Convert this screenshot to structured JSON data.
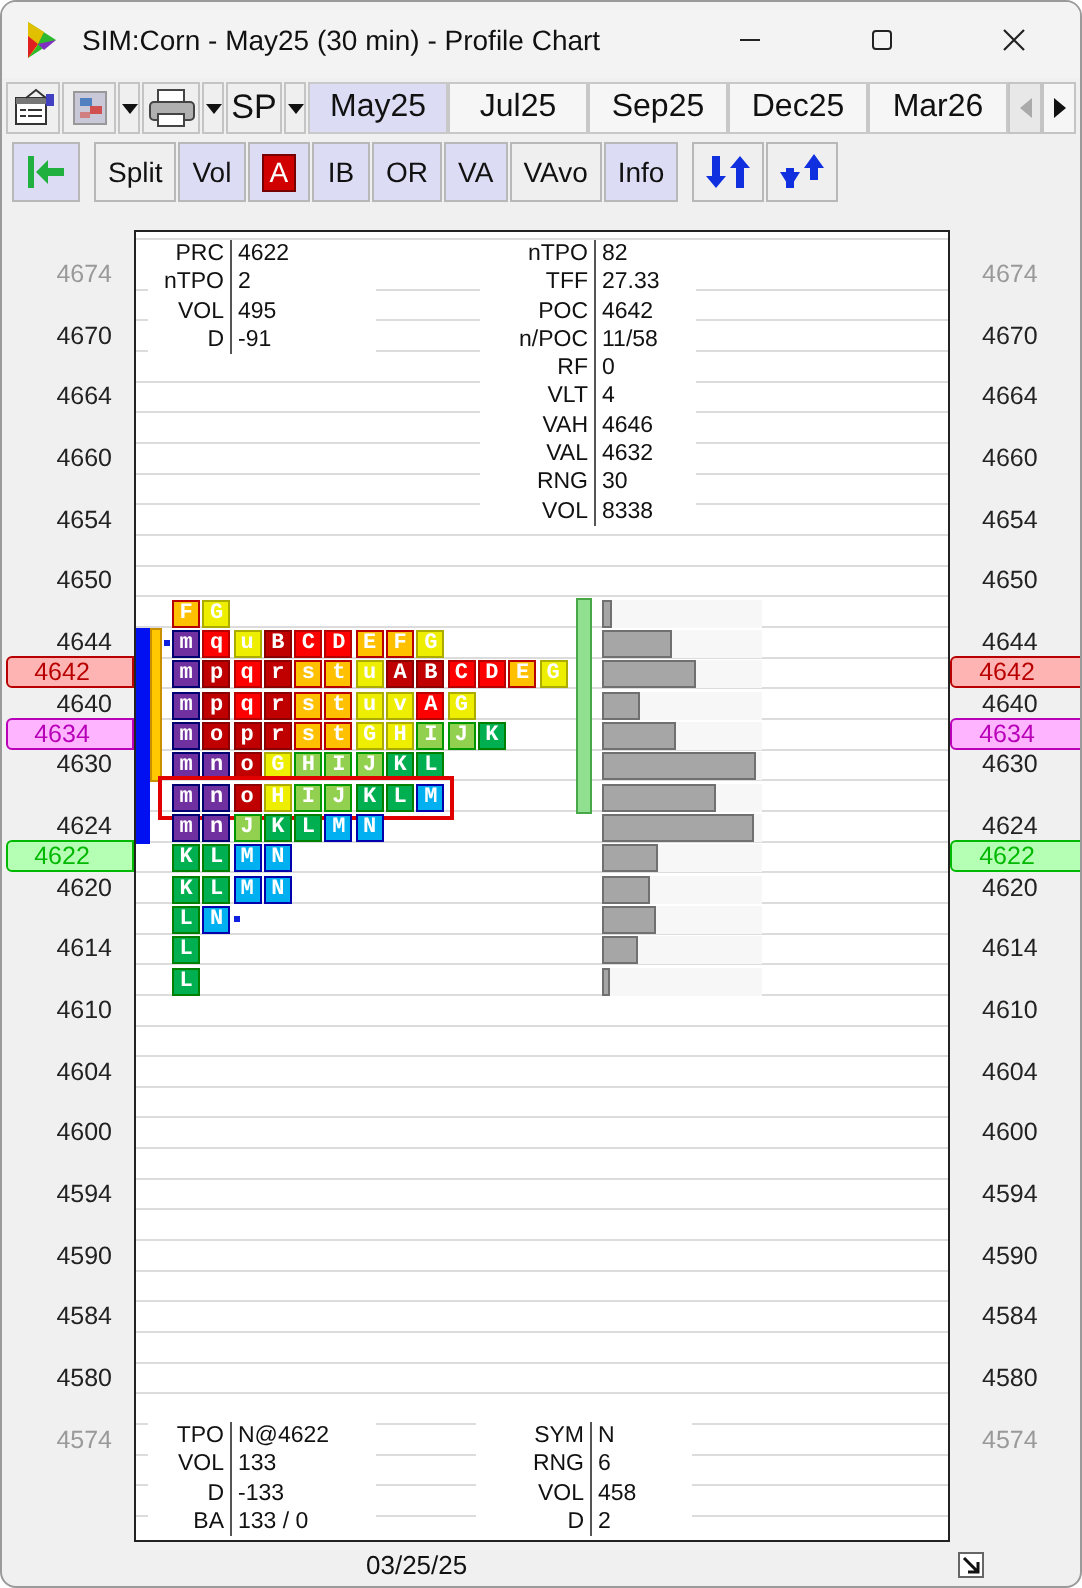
{
  "window": {
    "title": "SIM:Corn - May25 (30 min) - Profile Chart"
  },
  "toolbar": {
    "symbol": "SP",
    "tabs": [
      {
        "label": "May25",
        "selected": true
      },
      {
        "label": "Jul25",
        "selected": false
      },
      {
        "label": "Sep25",
        "selected": false
      },
      {
        "label": "Dec25",
        "selected": false
      },
      {
        "label": "Mar26",
        "selected": false
      }
    ],
    "scroll_left": {
      "disabled": true
    },
    "scroll_right": {
      "disabled": false
    }
  },
  "buttons": [
    {
      "kind": "jump",
      "on": true
    },
    {
      "kind": "text",
      "label": "Split",
      "on": false
    },
    {
      "kind": "text",
      "label": "Vol",
      "on": true
    },
    {
      "kind": "letter",
      "label": "A",
      "on": true
    },
    {
      "kind": "text",
      "label": "IB",
      "on": true
    },
    {
      "kind": "text",
      "label": "OR",
      "on": true
    },
    {
      "kind": "text",
      "label": "VA",
      "on": true
    },
    {
      "kind": "text",
      "label": "VAvo",
      "on": false
    },
    {
      "kind": "text",
      "label": "Info",
      "on": true
    },
    {
      "kind": "arrows-up",
      "on": false
    },
    {
      "kind": "arrows-down",
      "on": false
    }
  ],
  "price_axis_left": [
    {
      "kind": "tick",
      "text": "4674",
      "faded": true
    },
    {
      "kind": "tick",
      "text": "4670",
      "faded": false
    },
    {
      "kind": "tick",
      "text": "4664",
      "faded": false
    },
    {
      "kind": "tick",
      "text": "4660",
      "faded": false
    },
    {
      "kind": "tick",
      "text": "4654",
      "faded": false
    },
    {
      "kind": "tick",
      "text": "4650",
      "faded": false
    },
    {
      "kind": "tick",
      "text": "4644",
      "faded": false
    },
    {
      "kind": "marker",
      "text": "4642",
      "color": "#ffb4b4"
    },
    {
      "kind": "tick",
      "text": "4640",
      "faded": false
    },
    {
      "kind": "marker",
      "text": "4634",
      "color": "#ffb4ff"
    },
    {
      "kind": "tick",
      "text": "4630",
      "faded": false
    },
    {
      "kind": "tick",
      "text": "4624",
      "faded": false
    },
    {
      "kind": "marker",
      "text": "4622",
      "color": "#b4ffb4"
    },
    {
      "kind": "tick",
      "text": "4620",
      "faded": false
    },
    {
      "kind": "tick",
      "text": "4614",
      "faded": false
    },
    {
      "kind": "tick",
      "text": "4610",
      "faded": false
    },
    {
      "kind": "tick",
      "text": "4604",
      "faded": false
    },
    {
      "kind": "tick",
      "text": "4600",
      "faded": false
    },
    {
      "kind": "tick",
      "text": "4594",
      "faded": false
    },
    {
      "kind": "tick",
      "text": "4590",
      "faded": false
    },
    {
      "kind": "tick",
      "text": "4584",
      "faded": false
    },
    {
      "kind": "tick",
      "text": "4580",
      "faded": false
    },
    {
      "kind": "tick",
      "text": "4574",
      "faded": true
    }
  ],
  "price_axis_right": [
    {
      "kind": "tick",
      "text": "4674",
      "faded": true
    },
    {
      "kind": "tick",
      "text": "4670",
      "faded": false
    },
    {
      "kind": "tick",
      "text": "4664",
      "faded": false
    },
    {
      "kind": "tick",
      "text": "4660",
      "faded": false
    },
    {
      "kind": "tick",
      "text": "4654",
      "faded": false
    },
    {
      "kind": "tick",
      "text": "4650",
      "faded": false
    },
    {
      "kind": "tick",
      "text": "4644",
      "faded": false
    },
    {
      "kind": "marker",
      "text": "4642",
      "color": "#ffb4b4"
    },
    {
      "kind": "tick",
      "text": "4640",
      "faded": false
    },
    {
      "kind": "marker",
      "text": "4634",
      "color": "#ffb4ff"
    },
    {
      "kind": "tick",
      "text": "4630",
      "faded": false
    },
    {
      "kind": "tick",
      "text": "4624",
      "faded": false
    },
    {
      "kind": "marker",
      "text": "4622",
      "color": "#b4ffb4"
    },
    {
      "kind": "tick",
      "text": "4620",
      "faded": false
    },
    {
      "kind": "tick",
      "text": "4614",
      "faded": false
    },
    {
      "kind": "tick",
      "text": "4610",
      "faded": false
    },
    {
      "kind": "tick",
      "text": "4604",
      "faded": false
    },
    {
      "kind": "tick",
      "text": "4600",
      "faded": false
    },
    {
      "kind": "tick",
      "text": "4594",
      "faded": false
    },
    {
      "kind": "tick",
      "text": "4590",
      "faded": false
    },
    {
      "kind": "tick",
      "text": "4584",
      "faded": false
    },
    {
      "kind": "tick",
      "text": "4580",
      "faded": false
    },
    {
      "kind": "tick",
      "text": "4574",
      "faded": true
    }
  ],
  "info_top_left": [
    {
      "label": "PRC",
      "value": "4622"
    },
    {
      "label": "nTPO",
      "value": "2"
    },
    {
      "label": "VOL",
      "value": "495"
    },
    {
      "label": "D",
      "value": "-91"
    }
  ],
  "info_top_right": [
    {
      "label": "nTPO",
      "value": "82"
    },
    {
      "label": "TFF",
      "value": "27.33"
    },
    {
      "label": "POC",
      "value": "4642"
    },
    {
      "label": "n/POC",
      "value": "11/58"
    },
    {
      "label": "RF",
      "value": "0"
    },
    {
      "label": "VLT",
      "value": "4"
    },
    {
      "label": "VAH",
      "value": "4646"
    },
    {
      "label": "VAL",
      "value": "4632"
    },
    {
      "label": "RNG",
      "value": "30"
    },
    {
      "label": "VOL",
      "value": "8338"
    }
  ],
  "profile": {
    "rows": [
      {
        "selected": false,
        "ib": false,
        "va": false,
        "vol_va": true,
        "level": 0.06,
        "dot_before": false,
        "dot_after": false,
        "cells": [
          {
            "letter": "F",
            "color": "#ffc000"
          },
          {
            "letter": "G",
            "color": "#eeee00"
          }
        ]
      },
      {
        "selected": false,
        "ib": true,
        "va": true,
        "vol_va": true,
        "level": 0.44,
        "dot_before": true,
        "dot_after": false,
        "cells": [
          {
            "letter": "m",
            "color": "#7030a0"
          },
          {
            "letter": "q",
            "color": "#ff0000"
          },
          {
            "letter": "u",
            "color": "#eeee00"
          },
          {
            "letter": "B",
            "color": "#c00000"
          },
          {
            "letter": "C",
            "color": "#ff0000"
          },
          {
            "letter": "D",
            "color": "#ff0000"
          },
          {
            "letter": "E",
            "color": "#ffc000"
          },
          {
            "letter": "F",
            "color": "#ffc000"
          },
          {
            "letter": "G",
            "color": "#eeee00"
          }
        ]
      },
      {
        "selected": false,
        "ib": true,
        "va": true,
        "vol_va": true,
        "level": 0.59,
        "dot_before": false,
        "dot_after": false,
        "cells": [
          {
            "letter": "m",
            "color": "#7030a0"
          },
          {
            "letter": "p",
            "color": "#c00000"
          },
          {
            "letter": "q",
            "color": "#ff0000"
          },
          {
            "letter": "r",
            "color": "#c00000"
          },
          {
            "letter": "s",
            "color": "#ffc000"
          },
          {
            "letter": "t",
            "color": "#ffc000"
          },
          {
            "letter": "u",
            "color": "#eeee00"
          },
          {
            "letter": "A",
            "color": "#c00000"
          },
          {
            "letter": "B",
            "color": "#c00000"
          },
          {
            "letter": "C",
            "color": "#ff0000"
          },
          {
            "letter": "D",
            "color": "#ff0000"
          },
          {
            "letter": "E",
            "color": "#ffc000"
          },
          {
            "letter": "G",
            "color": "#eeee00"
          }
        ]
      },
      {
        "selected": false,
        "ib": true,
        "va": true,
        "vol_va": true,
        "level": 0.24,
        "dot_before": false,
        "dot_after": false,
        "cells": [
          {
            "letter": "m",
            "color": "#7030a0"
          },
          {
            "letter": "p",
            "color": "#c00000"
          },
          {
            "letter": "q",
            "color": "#ff0000"
          },
          {
            "letter": "r",
            "color": "#c00000"
          },
          {
            "letter": "s",
            "color": "#ffc000"
          },
          {
            "letter": "t",
            "color": "#ffc000"
          },
          {
            "letter": "u",
            "color": "#eeee00"
          },
          {
            "letter": "v",
            "color": "#eeee00"
          },
          {
            "letter": "A",
            "color": "#ff0000"
          },
          {
            "letter": "G",
            "color": "#eeee00"
          }
        ]
      },
      {
        "selected": false,
        "ib": true,
        "va": true,
        "vol_va": true,
        "level": 0.46,
        "dot_before": false,
        "dot_after": false,
        "cells": [
          {
            "letter": "m",
            "color": "#7030a0"
          },
          {
            "letter": "o",
            "color": "#c00000"
          },
          {
            "letter": "p",
            "color": "#c00000"
          },
          {
            "letter": "r",
            "color": "#c00000"
          },
          {
            "letter": "s",
            "color": "#ffc000"
          },
          {
            "letter": "t",
            "color": "#ffc000"
          },
          {
            "letter": "G",
            "color": "#eeee00"
          },
          {
            "letter": "H",
            "color": "#eeee00"
          },
          {
            "letter": "I",
            "color": "#92d050"
          },
          {
            "letter": "J",
            "color": "#92d050"
          },
          {
            "letter": "K",
            "color": "#00b050"
          }
        ]
      },
      {
        "selected": false,
        "ib": true,
        "va": true,
        "vol_va": true,
        "level": 0.96,
        "dot_before": false,
        "dot_after": false,
        "cells": [
          {
            "letter": "m",
            "color": "#7030a0"
          },
          {
            "letter": "n",
            "color": "#7030a0"
          },
          {
            "letter": "o",
            "color": "#c00000"
          },
          {
            "letter": "G",
            "color": "#eeee00"
          },
          {
            "letter": "H",
            "color": "#92d050"
          },
          {
            "letter": "I",
            "color": "#92d050"
          },
          {
            "letter": "J",
            "color": "#92d050"
          },
          {
            "letter": "K",
            "color": "#00b050"
          },
          {
            "letter": "L",
            "color": "#00b050"
          }
        ]
      },
      {
        "selected": true,
        "ib": true,
        "va": false,
        "vol_va": true,
        "level": 0.71,
        "dot_before": false,
        "dot_after": false,
        "cells": [
          {
            "letter": "m",
            "color": "#7030a0"
          },
          {
            "letter": "n",
            "color": "#7030a0"
          },
          {
            "letter": "o",
            "color": "#c00000"
          },
          {
            "letter": "H",
            "color": "#eeee00"
          },
          {
            "letter": "I",
            "color": "#92d050"
          },
          {
            "letter": "J",
            "color": "#92d050"
          },
          {
            "letter": "K",
            "color": "#00b050"
          },
          {
            "letter": "L",
            "color": "#00b050"
          },
          {
            "letter": "M",
            "color": "#00b0f0"
          }
        ]
      },
      {
        "selected": false,
        "ib": true,
        "va": false,
        "vol_va": false,
        "level": 0.95,
        "dot_before": false,
        "dot_after": false,
        "cells": [
          {
            "letter": "m",
            "color": "#7030a0"
          },
          {
            "letter": "n",
            "color": "#7030a0"
          },
          {
            "letter": "J",
            "color": "#92d050"
          },
          {
            "letter": "K",
            "color": "#00b050"
          },
          {
            "letter": "L",
            "color": "#00b050"
          },
          {
            "letter": "M",
            "color": "#00b0f0"
          },
          {
            "letter": "N",
            "color": "#00b0f0"
          }
        ]
      },
      {
        "selected": false,
        "ib": false,
        "va": false,
        "vol_va": false,
        "level": 0.35,
        "dot_before": false,
        "dot_after": false,
        "cells": [
          {
            "letter": "K",
            "color": "#00b050"
          },
          {
            "letter": "L",
            "color": "#00b050"
          },
          {
            "letter": "M",
            "color": "#00b0f0"
          },
          {
            "letter": "N",
            "color": "#00b0f0"
          }
        ]
      },
      {
        "selected": false,
        "ib": false,
        "va": false,
        "vol_va": false,
        "level": 0.3,
        "dot_before": false,
        "dot_after": false,
        "cells": [
          {
            "letter": "K",
            "color": "#00b050"
          },
          {
            "letter": "L",
            "color": "#00b050"
          },
          {
            "letter": "M",
            "color": "#00b0f0"
          },
          {
            "letter": "N",
            "color": "#00b0f0"
          }
        ]
      },
      {
        "selected": false,
        "ib": false,
        "va": false,
        "vol_va": false,
        "level": 0.34,
        "dot_before": false,
        "dot_after": true,
        "cells": [
          {
            "letter": "L",
            "color": "#00b050"
          },
          {
            "letter": "N",
            "color": "#00b0f0"
          }
        ]
      },
      {
        "selected": false,
        "ib": false,
        "va": false,
        "vol_va": false,
        "level": 0.23,
        "dot_before": false,
        "dot_after": false,
        "cells": [
          {
            "letter": "L",
            "color": "#00b050"
          }
        ]
      },
      {
        "selected": false,
        "ib": false,
        "va": false,
        "vol_va": false,
        "level": 0.05,
        "dot_before": false,
        "dot_after": false,
        "cells": [
          {
            "letter": "L",
            "color": "#00b050"
          }
        ]
      }
    ]
  },
  "info_bottom_left": [
    {
      "label": "TPO",
      "value": "N@4622"
    },
    {
      "label": "VOL",
      "value": "133"
    },
    {
      "label": "D",
      "value": "-133"
    },
    {
      "label": "BA",
      "value": "133 / 0"
    }
  ],
  "info_bottom_right": [
    {
      "label": "SYM",
      "value": "N"
    },
    {
      "label": "RNG",
      "value": "6"
    },
    {
      "label": "VOL",
      "value": "458"
    },
    {
      "label": "D",
      "value": "2"
    }
  ],
  "date": "03/25/25"
}
